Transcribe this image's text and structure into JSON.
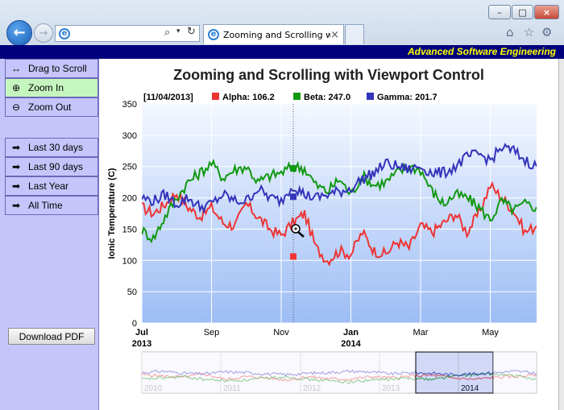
{
  "browser": {
    "tab_title": "Zooming and Scrolling wit...",
    "tab_close": "×",
    "minimize": "–",
    "maximize": "□",
    "close": "×"
  },
  "banner": {
    "text": "Advanced Software Engineering"
  },
  "sidebar": {
    "items": [
      {
        "label": "Drag to Scroll",
        "icon": "drag-arrows-icon",
        "active": false
      },
      {
        "label": "Zoom In",
        "icon": "zoom-in-icon",
        "active": true
      },
      {
        "label": "Zoom Out",
        "icon": "zoom-out-icon",
        "active": false
      },
      {
        "label": "Last 30 days",
        "icon": "arrow-right-icon",
        "active": false
      },
      {
        "label": "Last 90 days",
        "icon": "arrow-right-icon",
        "active": false
      },
      {
        "label": "Last Year",
        "icon": "arrow-right-icon",
        "active": false
      },
      {
        "label": "All Time",
        "icon": "arrow-right-icon",
        "active": false
      }
    ],
    "download_label": "Download PDF"
  },
  "chart_data": {
    "type": "line",
    "title": "Zooming and Scrolling with Viewport Control",
    "ylabel": "Ionic Temperature (C)",
    "ylim": [
      0,
      350
    ],
    "yticks": [
      0,
      50,
      100,
      150,
      200,
      250,
      300,
      350
    ],
    "xticks": [
      {
        "label": "Jul",
        "sub": "2013",
        "bold": true
      },
      {
        "label": "Sep",
        "sub": "",
        "bold": false
      },
      {
        "label": "Nov",
        "sub": "",
        "bold": false
      },
      {
        "label": "Jan",
        "sub": "2014",
        "bold": true
      },
      {
        "label": "Mar",
        "sub": "",
        "bold": false
      },
      {
        "label": "May",
        "sub": "",
        "bold": false
      }
    ],
    "cursor": {
      "date_label": "[11/04/2013]",
      "alpha_label": "Alpha: 106.2",
      "beta_label": "Beta: 247.0",
      "gamma_label": "Gamma: 201.7",
      "alpha": 106.2,
      "beta": 247.0,
      "gamma": 201.7
    },
    "colors": {
      "alpha": "#ee3333",
      "beta": "#119911",
      "gamma": "#3333bb"
    },
    "x_months": [
      0,
      0.33,
      0.67,
      1,
      1.33,
      1.67,
      2,
      2.33,
      2.67,
      3,
      3.33,
      3.67,
      4,
      4.33,
      4.67,
      5,
      5.33,
      5.67,
      6,
      6.33,
      6.67,
      7,
      7.33,
      7.67,
      8,
      8.33,
      8.67,
      9,
      9.33,
      9.67,
      10,
      10.33,
      10.67,
      11,
      11.33
    ],
    "series": [
      {
        "name": "Alpha",
        "values": [
          185,
          175,
          190,
          208,
          185,
          170,
          185,
          160,
          155,
          190,
          170,
          150,
          140,
          160,
          175,
          120,
          100,
          115,
          110,
          145,
          115,
          110,
          130,
          120,
          155,
          145,
          160,
          175,
          145,
          175,
          220,
          200,
          180,
          145,
          155
        ]
      },
      {
        "name": "Beta",
        "values": [
          148,
          135,
          170,
          200,
          225,
          240,
          255,
          232,
          245,
          250,
          225,
          235,
          240,
          250,
          247,
          220,
          210,
          230,
          205,
          235,
          220,
          225,
          240,
          250,
          245,
          210,
          190,
          205,
          200,
          185,
          165,
          195,
          180,
          190,
          185
        ]
      },
      {
        "name": "Gamma",
        "values": [
          200,
          195,
          205,
          190,
          200,
          185,
          190,
          205,
          195,
          195,
          215,
          200,
          195,
          220,
          205,
          200,
          205,
          210,
          215,
          230,
          240,
          255,
          250,
          245,
          250,
          240,
          240,
          250,
          265,
          270,
          260,
          280,
          275,
          260,
          250
        ]
      }
    ],
    "overview_labels": [
      "2010",
      "2011",
      "2012",
      "2013",
      "2014"
    ]
  }
}
